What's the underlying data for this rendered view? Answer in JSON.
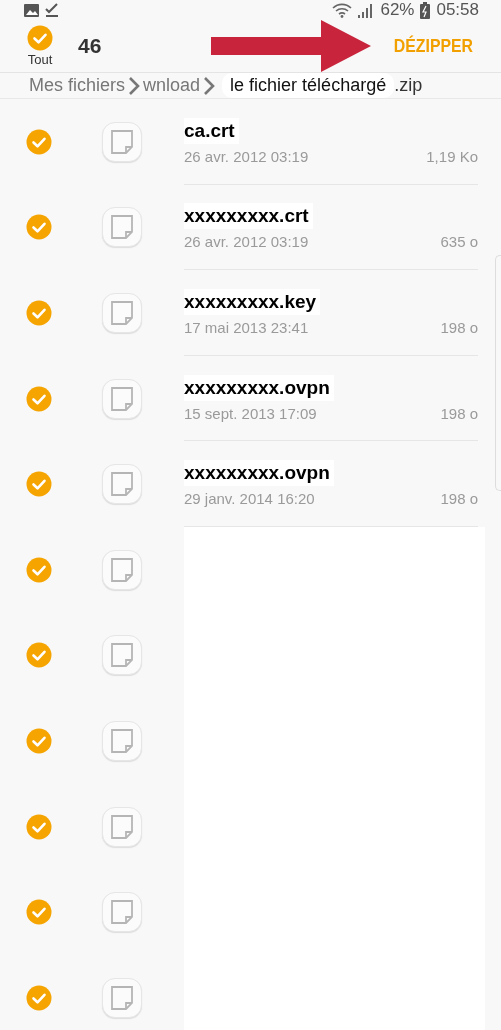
{
  "status_bar": {
    "battery": "62%",
    "time": "05:58"
  },
  "header": {
    "select_all": {
      "label": "Tout",
      "checked": true
    },
    "count": "46",
    "action": "DÉZIPPER"
  },
  "breadcrumb": {
    "items": [
      "Mes fichiers",
      "wnload"
    ],
    "current": "le fichier téléchargé",
    "suffix": ".zip"
  },
  "files": [
    {
      "kind": "file",
      "checked": true,
      "name": "ca.crt",
      "date": "26 avr. 2012 03:19",
      "size": "1,19 Ko"
    },
    {
      "kind": "file",
      "checked": true,
      "name": "xxxxxxxxx.crt",
      "date": "26 avr. 2012 03:19",
      "size": "635 o"
    },
    {
      "kind": "file",
      "checked": true,
      "name": "xxxxxxxxx.key",
      "date": "17 mai 2013 23:41",
      "size": "198 o"
    },
    {
      "kind": "file",
      "checked": true,
      "name": "xxxxxxxxx.ovpn",
      "date": "15 sept. 2013 17:09",
      "size": "198 o"
    },
    {
      "kind": "file",
      "checked": true,
      "name": "xxxxxxxxx.ovpn",
      "date": "29 janv. 2014 16:20",
      "size": "198 o"
    },
    {
      "kind": "hidden",
      "checked": true
    },
    {
      "kind": "hidden",
      "checked": true
    },
    {
      "kind": "hidden",
      "checked": true
    },
    {
      "kind": "hidden",
      "checked": true
    },
    {
      "kind": "hidden",
      "checked": true
    },
    {
      "kind": "hidden",
      "checked": true
    }
  ]
}
